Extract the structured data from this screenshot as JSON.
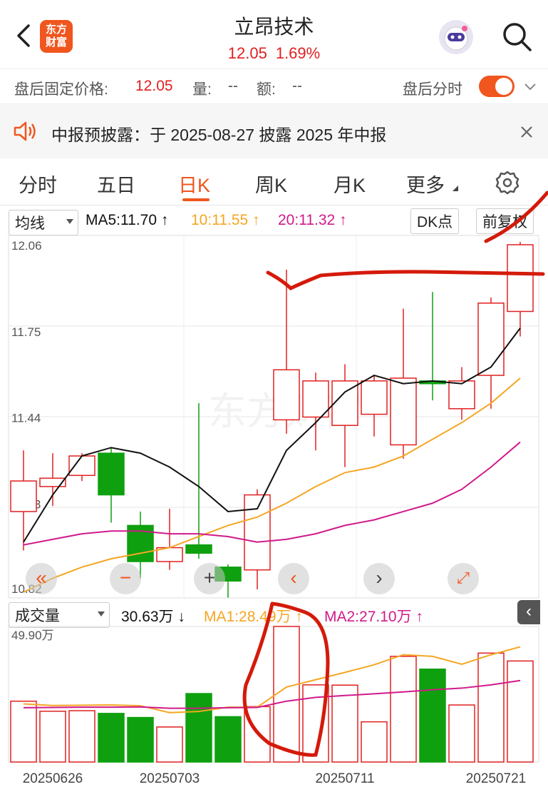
{
  "header": {
    "title": "立昂技术",
    "price": "12.05",
    "change_pct": "1.69%",
    "logo_text_line1": "东方",
    "logo_text_line2": "财富"
  },
  "afterhours": {
    "fixed_price_label": "盘后固定价格:",
    "fixed_price_value": "12.05",
    "volume_label": "量:",
    "volume_value": "--",
    "amount_label": "额:",
    "amount_value": "--",
    "intraday_label": "盘后分时"
  },
  "notice": {
    "text": "中报预披露：于 2025-08-27 披露 2025 年中报"
  },
  "tabs": [
    "分时",
    "五日",
    "日K",
    "周K",
    "月K",
    "更多"
  ],
  "active_tab": "日K",
  "ma_row": {
    "selector": "均线",
    "ma5": "MA5:11.70",
    "ma10": "10:11.55",
    "ma20": "20:11.32",
    "dk_button": "DK点",
    "adjust_button": "前复权"
  },
  "price_axis": [
    "12.06",
    "11.75",
    "11.44",
    "11.13",
    "10.82"
  ],
  "volume_row": {
    "selector": "成交量",
    "vol": "30.63万",
    "ma1": "MA1:28.49万",
    "ma2": "MA2:27.10万",
    "max_label": "49.90万"
  },
  "date_axis": [
    "20250626",
    "20250703",
    "20250711",
    "20250721"
  ],
  "watermark": "东方财富",
  "colors": {
    "up": "#e02020",
    "down": "#0fa00f",
    "ma5": "#111111",
    "ma10": "#f5a623",
    "ma20": "#d01a8a",
    "accent": "#f0561e"
  },
  "chart_data": {
    "type": "candlestick",
    "ylim": [
      10.82,
      12.06
    ],
    "candles": [
      {
        "open": 11.1,
        "close": 11.21,
        "high": 11.32,
        "low": 10.96
      },
      {
        "open": 11.19,
        "close": 11.22,
        "high": 11.31,
        "low": 11.12
      },
      {
        "open": 11.23,
        "close": 11.3,
        "high": 11.31,
        "low": 11.21
      },
      {
        "open": 11.31,
        "close": 11.16,
        "high": 11.33,
        "low": 11.06
      },
      {
        "open": 11.05,
        "close": 10.92,
        "high": 11.1,
        "low": 10.86
      },
      {
        "open": 10.92,
        "close": 10.97,
        "high": 11.11,
        "low": 10.89
      },
      {
        "open": 10.98,
        "close": 10.95,
        "high": 11.49,
        "low": 10.93
      },
      {
        "open": 10.9,
        "close": 10.85,
        "high": 10.91,
        "low": 10.79
      },
      {
        "open": 10.89,
        "close": 11.16,
        "high": 11.18,
        "low": 10.82
      },
      {
        "open": 11.43,
        "close": 11.61,
        "high": 11.97,
        "low": 11.38
      },
      {
        "open": 11.44,
        "close": 11.57,
        "high": 11.6,
        "low": 11.32
      },
      {
        "open": 11.41,
        "close": 11.57,
        "high": 11.63,
        "low": 11.26
      },
      {
        "open": 11.45,
        "close": 11.57,
        "high": 11.59,
        "low": 11.37
      },
      {
        "open": 11.34,
        "close": 11.58,
        "high": 11.83,
        "low": 11.29
      },
      {
        "open": 11.57,
        "close": 11.56,
        "high": 11.89,
        "low": 11.5
      },
      {
        "open": 11.47,
        "close": 11.57,
        "high": 11.62,
        "low": 11.43
      },
      {
        "open": 11.59,
        "close": 11.85,
        "high": 11.87,
        "low": 11.47
      },
      {
        "open": 11.82,
        "close": 12.06,
        "high": 12.07,
        "low": 11.73
      }
    ],
    "ma5": [
      10.99,
      11.16,
      11.3,
      11.33,
      11.31,
      11.26,
      11.19,
      11.1,
      11.11,
      11.32,
      11.42,
      11.53,
      11.59,
      11.56,
      11.57,
      11.56,
      11.62,
      11.76
    ],
    "ma10": [
      10.81,
      10.86,
      10.9,
      10.93,
      10.95,
      10.97,
      11.01,
      11.05,
      11.08,
      11.13,
      11.19,
      11.24,
      11.26,
      11.3,
      11.36,
      11.42,
      11.49,
      11.58
    ],
    "ma20": [
      10.98,
      11.0,
      11.02,
      11.03,
      11.03,
      11.02,
      11.02,
      11.01,
      10.99,
      11.0,
      11.02,
      11.05,
      11.07,
      11.1,
      11.13,
      11.18,
      11.26,
      11.35
    ],
    "volume": [
      22.4,
      18.7,
      18.9,
      17.9,
      16.4,
      12.9,
      25.2,
      16.7,
      20.4,
      49.9,
      28.4,
      28.3,
      14.8,
      38.9,
      34.2,
      21.0,
      40.1,
      37.2
    ],
    "vol_ma1": [
      21.4,
      20.8,
      20.9,
      21.0,
      20.7,
      18.2,
      18.6,
      20.2,
      20.2,
      27.6,
      30.3,
      33.0,
      35.8,
      39.5,
      38.9,
      36.0,
      39.5,
      42.4
    ],
    "vol_ma2": [
      20.0,
      20.1,
      20.2,
      20.2,
      20.3,
      19.8,
      19.8,
      20.0,
      20.1,
      22.4,
      23.8,
      24.5,
      25.1,
      25.8,
      26.6,
      27.2,
      28.4,
      30.0
    ]
  }
}
